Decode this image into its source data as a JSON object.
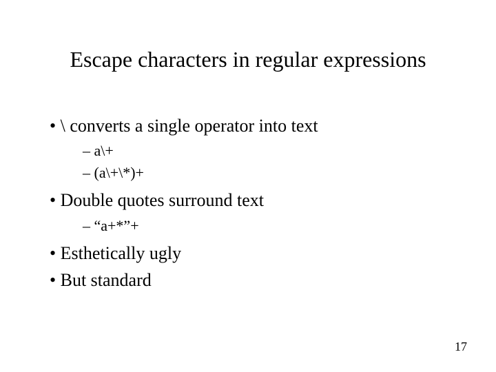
{
  "title": "Escape characters in regular expressions",
  "bullets": {
    "b1": "\\ converts a single operator into text",
    "b1_sub1": "a\\+",
    "b1_sub2": "(a\\+\\*)+",
    "b2": "Double quotes surround text",
    "b2_sub1": "“a+*”+",
    "b3": "Esthetically ugly",
    "b4": "But standard"
  },
  "page_number": "17"
}
